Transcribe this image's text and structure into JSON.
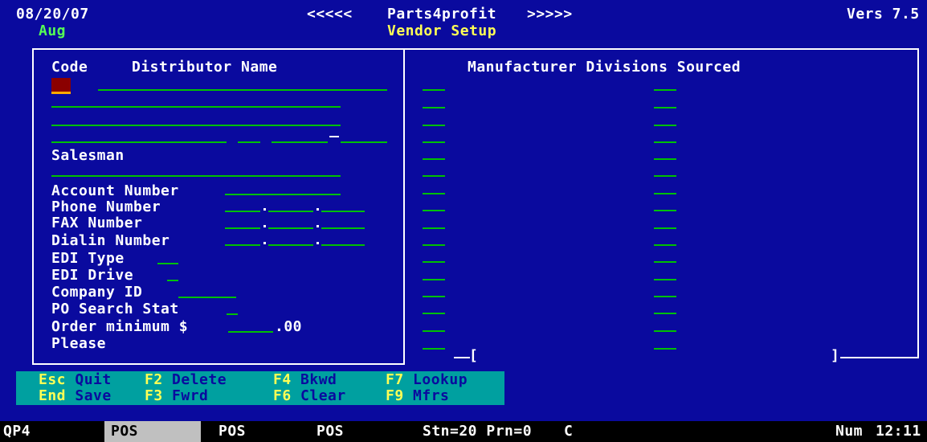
{
  "header": {
    "date": "08/20/07",
    "month": "Aug",
    "nav_left": "<<<<<",
    "app_name": "Parts4profit",
    "nav_right": ">>>>>",
    "screen_title": "Vendor Setup",
    "version": "Vers 7.5"
  },
  "left_panel": {
    "code_label": "Code",
    "distributor_name_label": "Distributor Name",
    "salesman_label": "Salesman",
    "account_number_label": "Account Number",
    "phone_number_label": "Phone Number",
    "fax_number_label": "FAX Number",
    "dialin_number_label": "Dialin Number",
    "edi_type_label": "EDI Type",
    "edi_drive_label": "EDI Drive",
    "company_id_label": "Company ID",
    "po_search_stat_label": "PO Search Stat",
    "order_minimum_label": "Order minimum $",
    "order_minimum_cents": ".00",
    "please_label": "Please"
  },
  "right_panel": {
    "title": "Manufacturer Divisions Sourced",
    "bracket_open": "[",
    "bracket_close": "]"
  },
  "function_keys": [
    {
      "key": "Esc",
      "label": "Quit"
    },
    {
      "key": "F2",
      "label": "Delete"
    },
    {
      "key": "F4",
      "label": "Bkwd"
    },
    {
      "key": "F7",
      "label": "Lookup"
    },
    {
      "key": "End",
      "label": "Save"
    },
    {
      "key": "F3",
      "label": "Fwrd"
    },
    {
      "key": "F6",
      "label": "Clear"
    },
    {
      "key": "F9",
      "label": "Mfrs"
    }
  ],
  "status_bar": {
    "program": "QP4",
    "pos1": "POS",
    "pos2": "POS",
    "pos3": "POS",
    "station_printer": "Stn=20 Prn=0",
    "mode": "C",
    "num": "Num",
    "time": "12:11"
  },
  "colors": {
    "background": "#0a0a9e",
    "field_underline": "#00c000",
    "label_text": "#ffffff",
    "highlight_text": "#ffff55",
    "month_text": "#55ff55",
    "function_bar": "#00a0a0",
    "active_cursor": "#8b0000"
  }
}
